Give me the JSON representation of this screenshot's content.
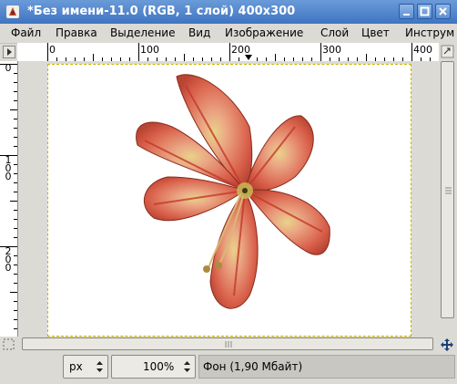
{
  "window": {
    "title": "*Без имени-11.0 (RGB, 1 слой) 400x300"
  },
  "menubar": {
    "items": [
      "Файл",
      "Правка",
      "Выделение",
      "Вид",
      "Изображение",
      "Слой",
      "Цвет",
      "Инструм"
    ]
  },
  "ruler_top": {
    "labels": [
      "0",
      "100",
      "200",
      "300",
      "400"
    ]
  },
  "ruler_left": {
    "labels": [
      "0",
      "100",
      "200"
    ]
  },
  "canvas": {
    "content": "flower-image",
    "selection_color": "#c8b400"
  },
  "statusbar": {
    "unit": "px",
    "zoom": "100%",
    "layer_info": "Фон (1,90 Мбайт)"
  },
  "colors": {
    "titlebar": "#4f84cc",
    "flower": "#e06a55"
  }
}
